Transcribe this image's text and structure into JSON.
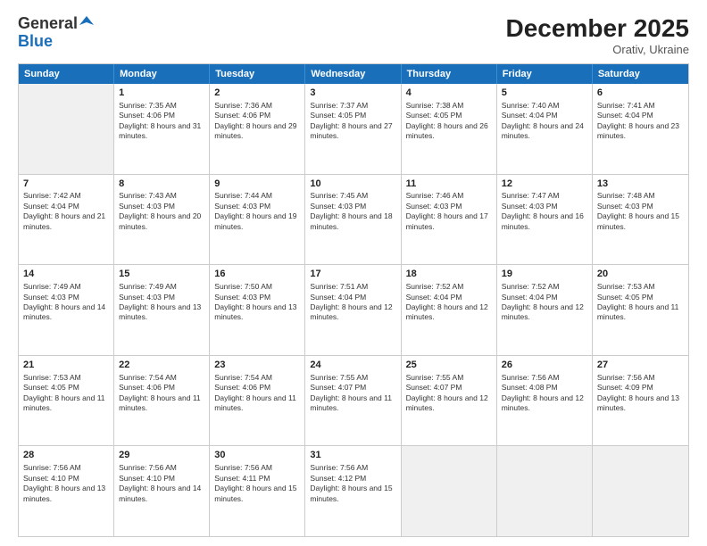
{
  "logo": {
    "general": "General",
    "blue": "Blue"
  },
  "title": "December 2025",
  "subtitle": "Orativ, Ukraine",
  "header": {
    "days": [
      "Sunday",
      "Monday",
      "Tuesday",
      "Wednesday",
      "Thursday",
      "Friday",
      "Saturday"
    ]
  },
  "weeks": [
    {
      "cells": [
        {
          "day": "",
          "empty": true,
          "shaded": true
        },
        {
          "day": "1",
          "sunrise": "7:35 AM",
          "sunset": "4:06 PM",
          "daylight": "8 hours and 31 minutes."
        },
        {
          "day": "2",
          "sunrise": "7:36 AM",
          "sunset": "4:06 PM",
          "daylight": "8 hours and 29 minutes."
        },
        {
          "day": "3",
          "sunrise": "7:37 AM",
          "sunset": "4:05 PM",
          "daylight": "8 hours and 27 minutes."
        },
        {
          "day": "4",
          "sunrise": "7:38 AM",
          "sunset": "4:05 PM",
          "daylight": "8 hours and 26 minutes."
        },
        {
          "day": "5",
          "sunrise": "7:40 AM",
          "sunset": "4:04 PM",
          "daylight": "8 hours and 24 minutes."
        },
        {
          "day": "6",
          "sunrise": "7:41 AM",
          "sunset": "4:04 PM",
          "daylight": "8 hours and 23 minutes."
        }
      ]
    },
    {
      "cells": [
        {
          "day": "7",
          "sunrise": "7:42 AM",
          "sunset": "4:04 PM",
          "daylight": "8 hours and 21 minutes."
        },
        {
          "day": "8",
          "sunrise": "7:43 AM",
          "sunset": "4:03 PM",
          "daylight": "8 hours and 20 minutes."
        },
        {
          "day": "9",
          "sunrise": "7:44 AM",
          "sunset": "4:03 PM",
          "daylight": "8 hours and 19 minutes."
        },
        {
          "day": "10",
          "sunrise": "7:45 AM",
          "sunset": "4:03 PM",
          "daylight": "8 hours and 18 minutes."
        },
        {
          "day": "11",
          "sunrise": "7:46 AM",
          "sunset": "4:03 PM",
          "daylight": "8 hours and 17 minutes."
        },
        {
          "day": "12",
          "sunrise": "7:47 AM",
          "sunset": "4:03 PM",
          "daylight": "8 hours and 16 minutes."
        },
        {
          "day": "13",
          "sunrise": "7:48 AM",
          "sunset": "4:03 PM",
          "daylight": "8 hours and 15 minutes."
        }
      ]
    },
    {
      "cells": [
        {
          "day": "14",
          "sunrise": "7:49 AM",
          "sunset": "4:03 PM",
          "daylight": "8 hours and 14 minutes."
        },
        {
          "day": "15",
          "sunrise": "7:49 AM",
          "sunset": "4:03 PM",
          "daylight": "8 hours and 13 minutes."
        },
        {
          "day": "16",
          "sunrise": "7:50 AM",
          "sunset": "4:03 PM",
          "daylight": "8 hours and 13 minutes."
        },
        {
          "day": "17",
          "sunrise": "7:51 AM",
          "sunset": "4:04 PM",
          "daylight": "8 hours and 12 minutes."
        },
        {
          "day": "18",
          "sunrise": "7:52 AM",
          "sunset": "4:04 PM",
          "daylight": "8 hours and 12 minutes."
        },
        {
          "day": "19",
          "sunrise": "7:52 AM",
          "sunset": "4:04 PM",
          "daylight": "8 hours and 12 minutes."
        },
        {
          "day": "20",
          "sunrise": "7:53 AM",
          "sunset": "4:05 PM",
          "daylight": "8 hours and 11 minutes."
        }
      ]
    },
    {
      "cells": [
        {
          "day": "21",
          "sunrise": "7:53 AM",
          "sunset": "4:05 PM",
          "daylight": "8 hours and 11 minutes."
        },
        {
          "day": "22",
          "sunrise": "7:54 AM",
          "sunset": "4:06 PM",
          "daylight": "8 hours and 11 minutes."
        },
        {
          "day": "23",
          "sunrise": "7:54 AM",
          "sunset": "4:06 PM",
          "daylight": "8 hours and 11 minutes."
        },
        {
          "day": "24",
          "sunrise": "7:55 AM",
          "sunset": "4:07 PM",
          "daylight": "8 hours and 11 minutes."
        },
        {
          "day": "25",
          "sunrise": "7:55 AM",
          "sunset": "4:07 PM",
          "daylight": "8 hours and 12 minutes."
        },
        {
          "day": "26",
          "sunrise": "7:56 AM",
          "sunset": "4:08 PM",
          "daylight": "8 hours and 12 minutes."
        },
        {
          "day": "27",
          "sunrise": "7:56 AM",
          "sunset": "4:09 PM",
          "daylight": "8 hours and 13 minutes."
        }
      ]
    },
    {
      "cells": [
        {
          "day": "28",
          "sunrise": "7:56 AM",
          "sunset": "4:10 PM",
          "daylight": "8 hours and 13 minutes."
        },
        {
          "day": "29",
          "sunrise": "7:56 AM",
          "sunset": "4:10 PM",
          "daylight": "8 hours and 14 minutes."
        },
        {
          "day": "30",
          "sunrise": "7:56 AM",
          "sunset": "4:11 PM",
          "daylight": "8 hours and 15 minutes."
        },
        {
          "day": "31",
          "sunrise": "7:56 AM",
          "sunset": "4:12 PM",
          "daylight": "8 hours and 15 minutes."
        },
        {
          "day": "",
          "empty": true,
          "shaded": true
        },
        {
          "day": "",
          "empty": true,
          "shaded": true
        },
        {
          "day": "",
          "empty": true,
          "shaded": true
        }
      ]
    }
  ],
  "labels": {
    "sunrise": "Sunrise:",
    "sunset": "Sunset:",
    "daylight": "Daylight:"
  }
}
